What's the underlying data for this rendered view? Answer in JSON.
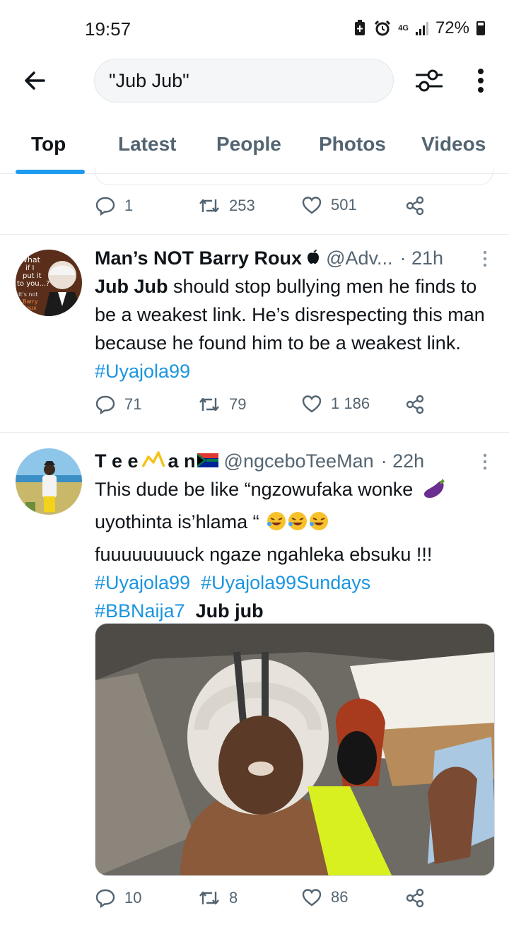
{
  "status_bar": {
    "time": "19:57",
    "network": "4G",
    "battery": "72%"
  },
  "search": {
    "query": "\"Jub Jub\""
  },
  "tabs": [
    {
      "label": "Top",
      "active": true
    },
    {
      "label": "Latest",
      "active": false
    },
    {
      "label": "People",
      "active": false
    },
    {
      "label": "Photos",
      "active": false
    },
    {
      "label": "Videos",
      "active": false
    }
  ],
  "previous_tweet": {
    "replies": "1",
    "retweets": "253",
    "likes": "501"
  },
  "tweets": [
    {
      "name": "Man’s NOT Barry Roux",
      "handle": "@Adv...",
      "time": "· 21h",
      "text": {
        "bold_lead": "Jub Jub",
        "line": " should stop bullying men he finds to be a weakest link. He’s disrespecting this man because he found him to be a weakest link. ",
        "hashtag": "#Uyajola99"
      },
      "avatar_text": [
        "What",
        "if I",
        "put it",
        "to you...?",
        "It's not",
        "Barry",
        "Roux"
      ],
      "replies": "71",
      "retweets": "79",
      "likes": "1 186"
    },
    {
      "name": "T e e",
      "name_suffix": "a n",
      "handle": "@ngceboTeeMan",
      "time": "· 22h",
      "text": {
        "line1": "This dude be like “ngzowufaka wonke",
        "line2": "uyothinta is’hlama “",
        "line3": "fuuuuuuuuck ngaze ngahleka ebsuku !!!",
        "hashtag1": "#Uyajola99",
        "hashtag2": "#Uyajola99Sundays",
        "hashtag3": "#BBNaija7",
        "bold_tail": "Jub jub"
      },
      "replies": "10",
      "retweets": "8",
      "likes": "86"
    }
  ],
  "colors": {
    "accent": "#1d9bf0",
    "hashtag": "#1b95e0",
    "muted": "#536471",
    "divider": "#e6ecf0"
  }
}
